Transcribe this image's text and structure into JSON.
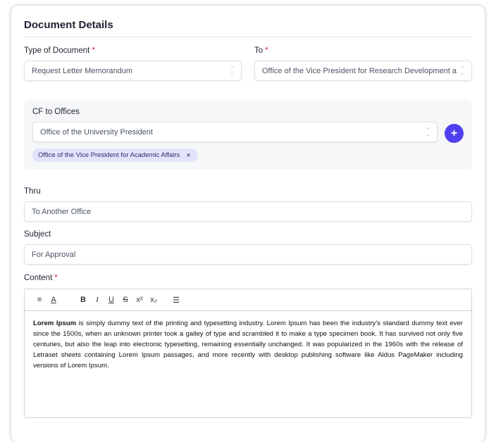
{
  "section_title": "Document Details",
  "type_of_document": {
    "label": "Type of Document",
    "required": "*",
    "value": "Request Letter Memorandum"
  },
  "to": {
    "label": "To",
    "required": "*",
    "value": "Office of the Vice President for Research Development a"
  },
  "cf": {
    "label": "CF to Offices",
    "value": "Office of the University President",
    "add_label": "+",
    "chips": [
      {
        "label": "Office of the Vice President for Academic Affairs",
        "remove": "×"
      }
    ]
  },
  "thru": {
    "label": "Thru",
    "value": "To Another Office"
  },
  "subject": {
    "label": "Subject",
    "value": "For Approval"
  },
  "content": {
    "label": "Content",
    "required": "*",
    "toolbar": {
      "align": "≡",
      "font_color": "A",
      "bold": "B",
      "italic": "I",
      "underline": "U",
      "strike": "S",
      "superscript": "x²",
      "subscript": "x₂",
      "list": "☰"
    },
    "bold_lead": "Lorem Ipsum",
    "text": " is simply dummy text of the printing and typesetting industry. Lorem Ipsum has been the industry's standard dummy text ever since the 1500s, when an unknown printer took a galley of type and scrambled it to make a type specimen book. It has survived not only five centuries, but also the leap into electronic typesetting, remaining essentially unchanged. It was popularized in the 1960s with the release of Letraset sheets containing Lorem Ipsum passages, and more recently with desktop publishing software like Aldus PageMaker including versions of Lorem Ipsum."
  },
  "colors": {
    "accent": "#4f3ff0",
    "required": "#e11d48",
    "chip_bg": "#e1e4fb"
  }
}
